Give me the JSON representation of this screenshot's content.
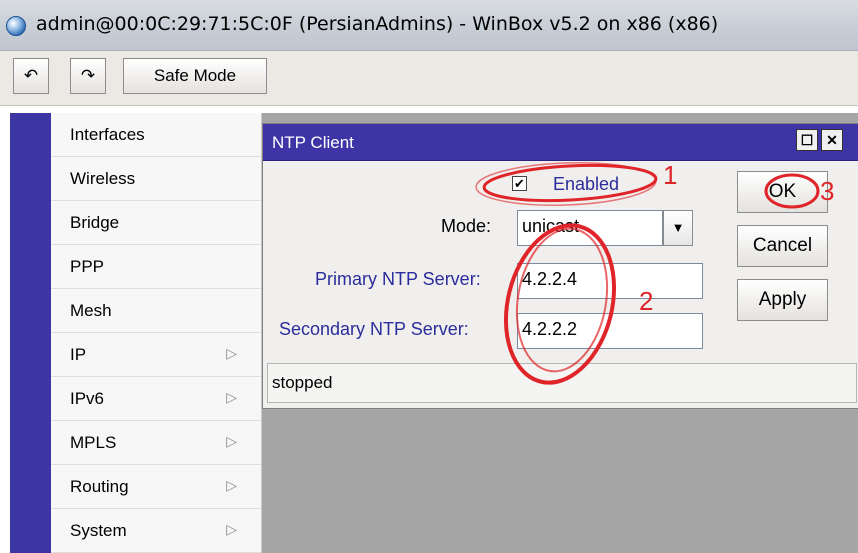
{
  "window": {
    "title": "admin@00:0C:29:71:5C:0F (PersianAdmins) - WinBox v5.2 on x86 (x86)"
  },
  "toolbar": {
    "undo_icon": "undo-arrow-icon",
    "redo_icon": "redo-arrow-icon",
    "undo_glyph": "↶",
    "redo_glyph": "↷",
    "safe_mode_label": "Safe Mode"
  },
  "sidebar": {
    "items": [
      {
        "label": "Interfaces",
        "has_submenu": false
      },
      {
        "label": "Wireless",
        "has_submenu": false
      },
      {
        "label": "Bridge",
        "has_submenu": false
      },
      {
        "label": "PPP",
        "has_submenu": false
      },
      {
        "label": "Mesh",
        "has_submenu": false
      },
      {
        "label": "IP",
        "has_submenu": true
      },
      {
        "label": "IPv6",
        "has_submenu": true
      },
      {
        "label": "MPLS",
        "has_submenu": true
      },
      {
        "label": "Routing",
        "has_submenu": true
      },
      {
        "label": "System",
        "has_submenu": true
      }
    ],
    "arrow_glyph": "▷"
  },
  "dialog": {
    "title": "NTP Client",
    "max_glyph": "☐",
    "close_glyph": "✕",
    "enabled_checked": true,
    "enabled_check_glyph": "✔",
    "enabled_label": "Enabled",
    "mode_label": "Mode:",
    "mode_value": "unicast",
    "dropdown_glyph": "▼",
    "primary_label": "Primary NTP Server:",
    "primary_value": "4.2.2.4",
    "secondary_label": "Secondary NTP Server:",
    "secondary_value": "4.2.2.2",
    "status": "stopped",
    "buttons": {
      "ok": "OK",
      "cancel": "Cancel",
      "apply": "Apply"
    }
  },
  "annotations": {
    "step1": "1",
    "step2": "2",
    "step3": "3",
    "color": "#e0252a"
  },
  "colors": {
    "sidebar_accent": "#3b36a3",
    "dialog_titlebar": "#3d35a6",
    "workspace": "#a6a6a6",
    "label_blue": "#2a2d9b"
  }
}
